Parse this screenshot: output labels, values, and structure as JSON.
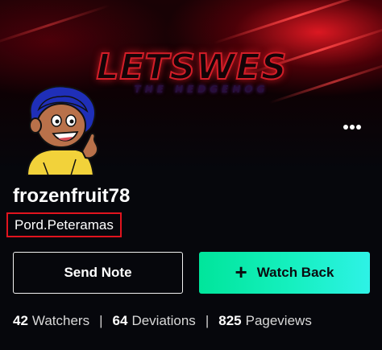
{
  "banner": {
    "logo_text": "LETSWES",
    "tagline": "THE HEDGEHOG",
    "accent_color": "#d21e28"
  },
  "profile": {
    "username": "frozenfruit78",
    "display_name": "Pord.Peteramas",
    "avatar_icon": "cartoon-character-avatar",
    "more_icon": "more-options-icon"
  },
  "actions": {
    "send_note_label": "Send Note",
    "watch_back_label": "Watch Back",
    "watch_back_icon": "plus-icon",
    "watch_back_color": "#16f0c0"
  },
  "stats": {
    "watchers_count": "42",
    "watchers_label": "Watchers",
    "deviations_count": "64",
    "deviations_label": "Deviations",
    "pageviews_count": "825",
    "pageviews_label": "Pageviews",
    "separator": "|"
  }
}
